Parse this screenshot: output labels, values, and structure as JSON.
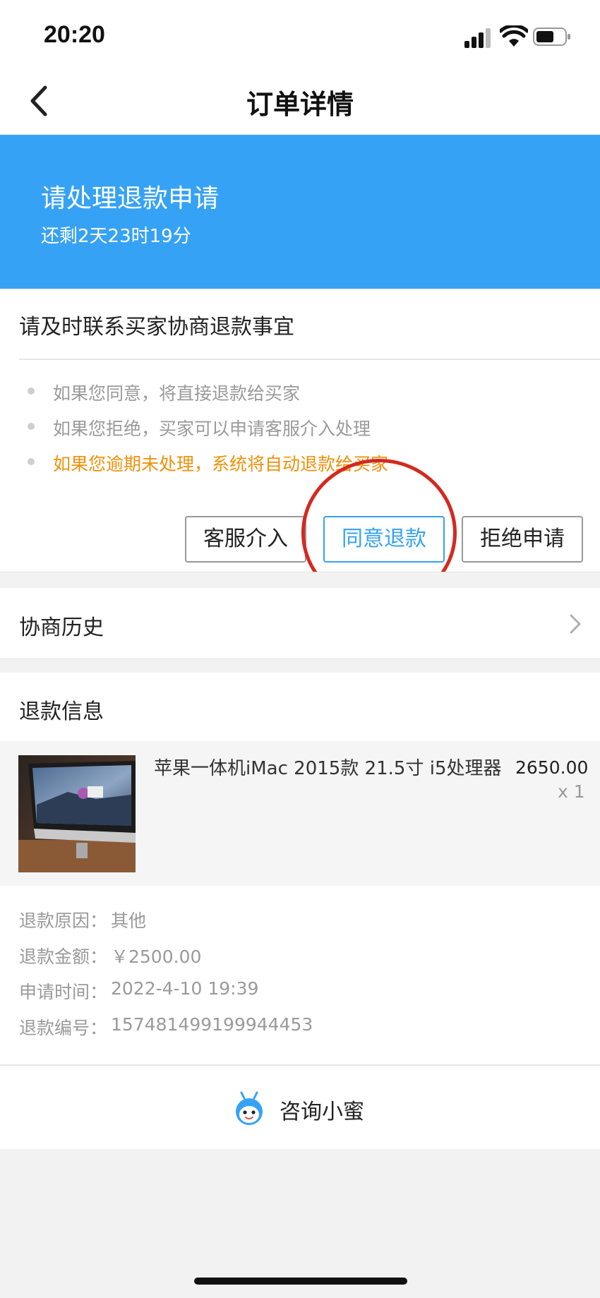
{
  "status_bar": {
    "time": "20:20"
  },
  "nav": {
    "title": "订单详情"
  },
  "banner": {
    "title": "请处理退款申请",
    "countdown": "还剩2天23时19分"
  },
  "notice": {
    "heading": "请及时联系买家协商退款事宜",
    "tips": [
      "如果您同意，将直接退款给买家",
      "如果您拒绝，买家可以申请客服介入处理",
      "如果您逾期未处理，系统将自动退款给买家"
    ],
    "warning_color": "#f0900a"
  },
  "actions": {
    "customer_service": "客服介入",
    "agree_refund": "同意退款",
    "reject_request": "拒绝申请"
  },
  "history": {
    "label": "协商历史"
  },
  "refund_info": {
    "heading": "退款信息",
    "product": {
      "name": "苹果一体机iMac 2015款 21.5寸 i5处理器",
      "price": "2650.00",
      "quantity": "x 1"
    },
    "details": [
      {
        "label": "退款原因：",
        "value": "其他"
      },
      {
        "label": "退款金额：",
        "value": "￥2500.00"
      },
      {
        "label": "申请时间：",
        "value": "2022-4-10 19:39"
      },
      {
        "label": "退款编号：",
        "value": "157481499199944453"
      }
    ]
  },
  "consult": {
    "label": "咨询小蜜",
    "icon": "mascot-icon"
  },
  "colors": {
    "accent": "#36a2f5",
    "highlight_circle": "#d4291f"
  }
}
